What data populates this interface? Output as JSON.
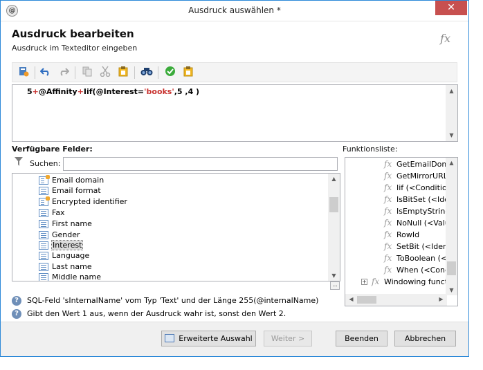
{
  "window": {
    "title": "Ausdruck auswählen *",
    "close_glyph": "✕",
    "app_icon_glyph": "@"
  },
  "header": {
    "title": "Ausdruck bearbeiten",
    "subtitle": "Ausdruck im Texteditor eingeben",
    "fx_glyph": "fx"
  },
  "toolbar": {
    "icons": [
      "add-field-icon",
      "undo-icon",
      "redo-icon",
      "copy-icon",
      "cut-icon",
      "paste-icon",
      "find-icon",
      "check-icon",
      "paste-special-icon"
    ]
  },
  "editor": {
    "tokens": {
      "t1": "5",
      "t2": "+",
      "t3": "@Affinity",
      "t4": "+",
      "t5": "Iif(@Interest=",
      "t6": "'books'",
      "t7": ",5 ,4 )"
    }
  },
  "fields": {
    "label": "Verfügbare Felder:",
    "search_label": "Suchen:",
    "search_value": "",
    "items": [
      {
        "label": "Email domain",
        "icon": "computed-field-icon"
      },
      {
        "label": "Email format",
        "icon": "list-field-icon"
      },
      {
        "label": "Encrypted identifier",
        "icon": "computed-field-icon"
      },
      {
        "label": "Fax",
        "icon": "list-field-icon"
      },
      {
        "label": "First name",
        "icon": "list-field-icon"
      },
      {
        "label": "Gender",
        "icon": "list-field-icon"
      },
      {
        "label": "Interest",
        "icon": "list-field-icon"
      },
      {
        "label": "Language",
        "icon": "list-field-icon"
      },
      {
        "label": "Last name",
        "icon": "list-field-icon"
      },
      {
        "label": "Middle name",
        "icon": "list-field-icon"
      }
    ],
    "ellipsis": "..."
  },
  "functions": {
    "label": "Funktionsliste:",
    "items": [
      {
        "label": "GetEmailDom"
      },
      {
        "label": "GetMirrorURL"
      },
      {
        "label": "Iif (<Conditio"
      },
      {
        "label": "IsBitSet (<Iden"
      },
      {
        "label": "IsEmptyString"
      },
      {
        "label": "NoNull (<Valu"
      },
      {
        "label": "RowId"
      },
      {
        "label": "SetBit (<Ident"
      },
      {
        "label": "ToBoolean (<"
      },
      {
        "label": "When (<Cond"
      }
    ],
    "group": {
      "label": "Windowing funct",
      "expander": "+"
    }
  },
  "info": {
    "line1": "SQL-Feld 'sInternalName' vom Typ 'Text' und der Länge 255(@internalName)",
    "line2": "Gibt den Wert 1 aus, wenn der Ausdruck wahr ist, sonst den Wert 2."
  },
  "footer": {
    "advanced_label": "Erweiterte Auswahl",
    "next_label": "Weiter >",
    "finish_label": "Beenden",
    "cancel_label": "Abbrechen"
  }
}
